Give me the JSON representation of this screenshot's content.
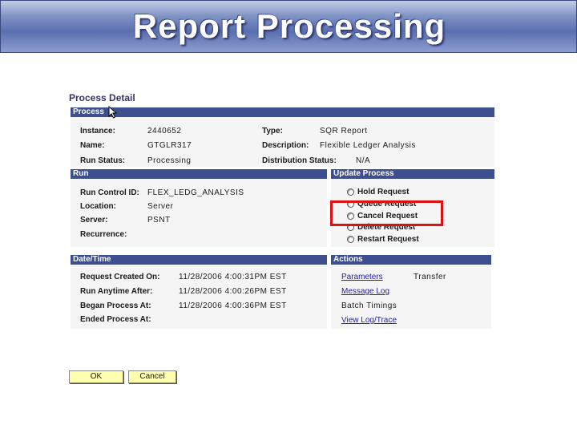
{
  "slide": {
    "title": "Report Processing"
  },
  "page": {
    "title": "Process Detail"
  },
  "process": {
    "header": "Process",
    "instance_label": "Instance:",
    "instance_value": "2440652",
    "type_label": "Type:",
    "type_value": "SQR Report",
    "name_label": "Name:",
    "name_value": "GTGLR317",
    "description_label": "Description:",
    "description_value": "Flexible Ledger Analysis",
    "run_status_label": "Run Status:",
    "run_status_value": "Processing",
    "distribution_status_label": "Distribution Status:",
    "distribution_status_value": "N/A"
  },
  "run": {
    "header": "Run",
    "run_control_id_label": "Run Control ID:",
    "run_control_id_value": "FLEX_LEDG_ANALYSIS",
    "location_label": "Location:",
    "location_value": "Server",
    "server_label": "Server:",
    "server_value": "PSNT",
    "recurrence_label": "Recurrence:",
    "recurrence_value": ""
  },
  "update_process": {
    "header": "Update Process",
    "options": [
      {
        "label": "Hold Request"
      },
      {
        "label": "Queue Request"
      },
      {
        "label": "Cancel Request"
      },
      {
        "label": "Delete Request"
      },
      {
        "label": "Restart Request"
      }
    ]
  },
  "date_time": {
    "header": "Date/Time",
    "request_created_label": "Request Created On:",
    "request_created_value": "11/28/2006  4:00:31PM EST",
    "run_anytime_label": "Run Anytime After:",
    "run_anytime_value": "11/28/2006  4:00:26PM EST",
    "began_process_label": "Began Process At:",
    "began_process_value": "11/28/2006  4:00:36PM EST",
    "ended_process_label": "Ended Process At:",
    "ended_process_value": ""
  },
  "actions": {
    "header": "Actions",
    "parameters": "Parameters",
    "transfer": "Transfer",
    "message_log": "Message Log",
    "batch_timings": "Batch Timings",
    "view_log_trace": "View Log/Trace"
  },
  "buttons": {
    "ok": "OK",
    "cancel": "Cancel"
  },
  "colors": {
    "group_header": "#3e4f8f",
    "highlight": "#e01010",
    "button": "#ffffb0"
  }
}
